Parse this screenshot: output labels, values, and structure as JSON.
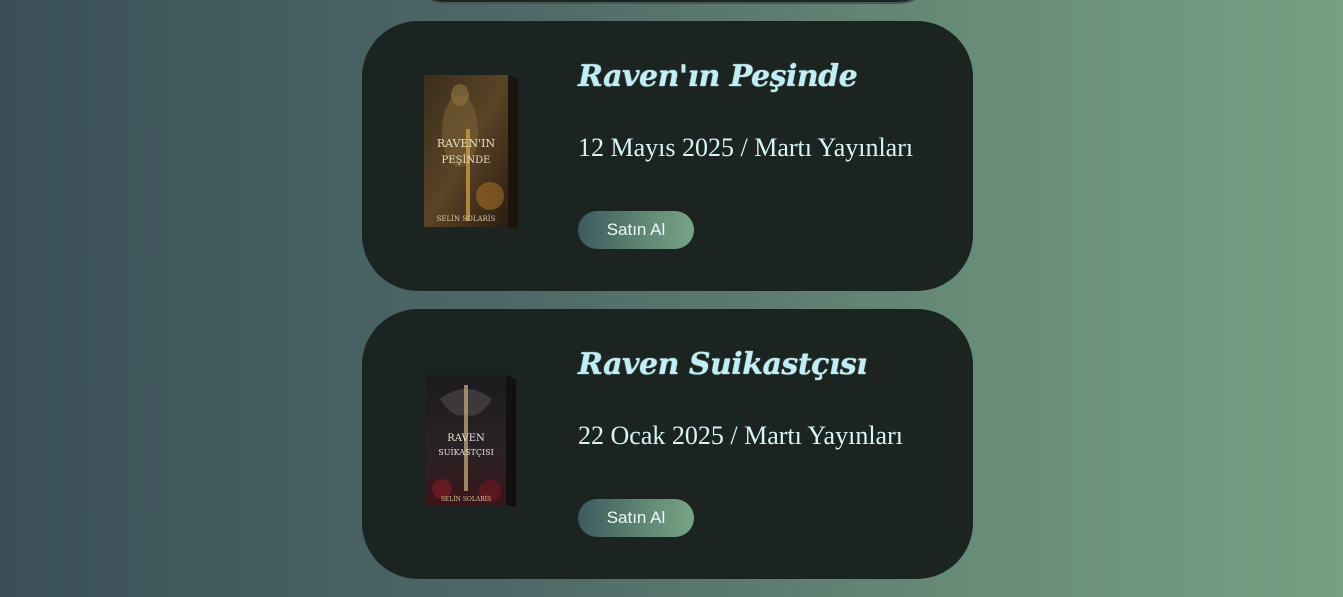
{
  "books": [
    {
      "title": "Raven'ın Peşinde",
      "meta": "12 Mayıs 2025 / Martı Yayınları",
      "buy_label": "Satın Al",
      "cover_icon": "book-cover-ravenin-pesinde",
      "cover_text_line1": "RAVEN'IN",
      "cover_text_line2": "PEŞİNDE",
      "cover_author": "SELİN SOLARİS"
    },
    {
      "title": "Raven Suikastçısı",
      "meta": "22 Ocak 2025 / Martı Yayınları",
      "buy_label": "Satın Al",
      "cover_icon": "book-cover-raven-suikastcisi",
      "cover_text_line1": "RAVEN",
      "cover_text_line2": "SUİKASTÇISI",
      "cover_author": "SELİN SOLARİS"
    }
  ],
  "colors": {
    "background_left": "#3a4f57",
    "background_right": "#75a083",
    "card": "#1b2421",
    "title": "#bfeff5",
    "button_gradient_start": "#3d5a60",
    "button_gradient_end": "#77a385"
  }
}
